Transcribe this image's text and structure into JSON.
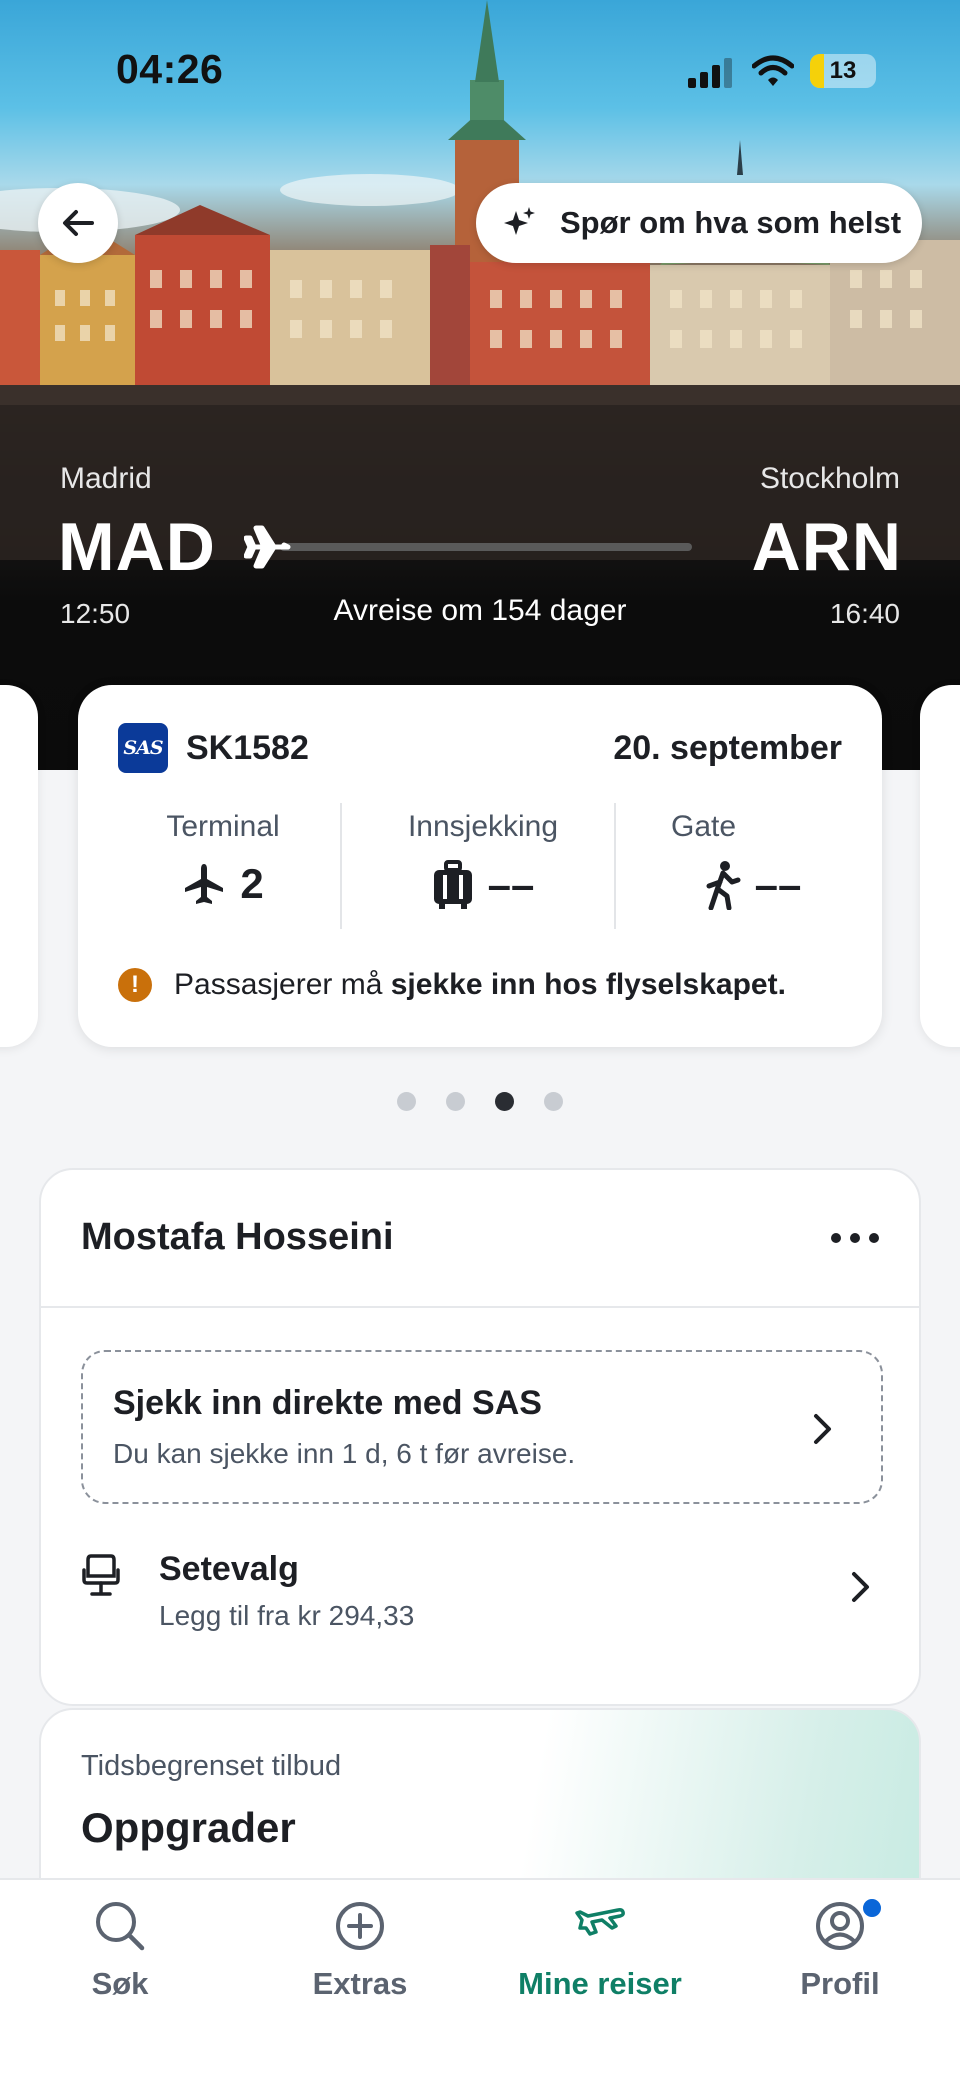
{
  "status_bar": {
    "time": "04:26",
    "battery": "13"
  },
  "header": {
    "ask_label": "Spør om hva som helst"
  },
  "route": {
    "origin_city": "Madrid",
    "origin_code": "MAD",
    "origin_time": "12:50",
    "destination_city": "Stockholm",
    "destination_code": "ARN",
    "destination_time": "16:40",
    "departure_text": "Avreise om 154 dager"
  },
  "flight_card": {
    "flight_number": "SK1582",
    "airline_logo": "SAS",
    "date": "20. september",
    "terminal_label": "Terminal",
    "terminal_value": "2",
    "checkin_label": "Innsjekking",
    "checkin_value": "––",
    "gate_label": "Gate",
    "gate_value": "––",
    "notice_prefix": "Passasjerer må ",
    "notice_bold": "sjekke inn hos flyselskapet."
  },
  "pagination": {
    "count": 4,
    "active": 3
  },
  "passenger": {
    "name": "Mostafa Hosseini",
    "checkin_title": "Sjekk inn direkte med SAS",
    "checkin_sub": "Du kan sjekke inn 1 d, 6 t før avreise.",
    "seat_title": "Setevalg",
    "seat_sub": "Legg til fra kr 294,33"
  },
  "offer": {
    "tag": "Tidsbegrenset tilbud",
    "title": "Oppgrader"
  },
  "tabbar": {
    "items": [
      {
        "label": "Søk",
        "icon": "search-icon"
      },
      {
        "label": "Extras",
        "icon": "plus-circle-icon"
      },
      {
        "label": "Mine reiser",
        "icon": "plane-icon",
        "active": true
      },
      {
        "label": "Profil",
        "icon": "profile-icon"
      }
    ]
  },
  "colors": {
    "accent_green": "#0f7f66",
    "sas_blue": "#0b3a99",
    "warning_orange": "#c9700b",
    "notification_blue": "#0a66d8"
  }
}
